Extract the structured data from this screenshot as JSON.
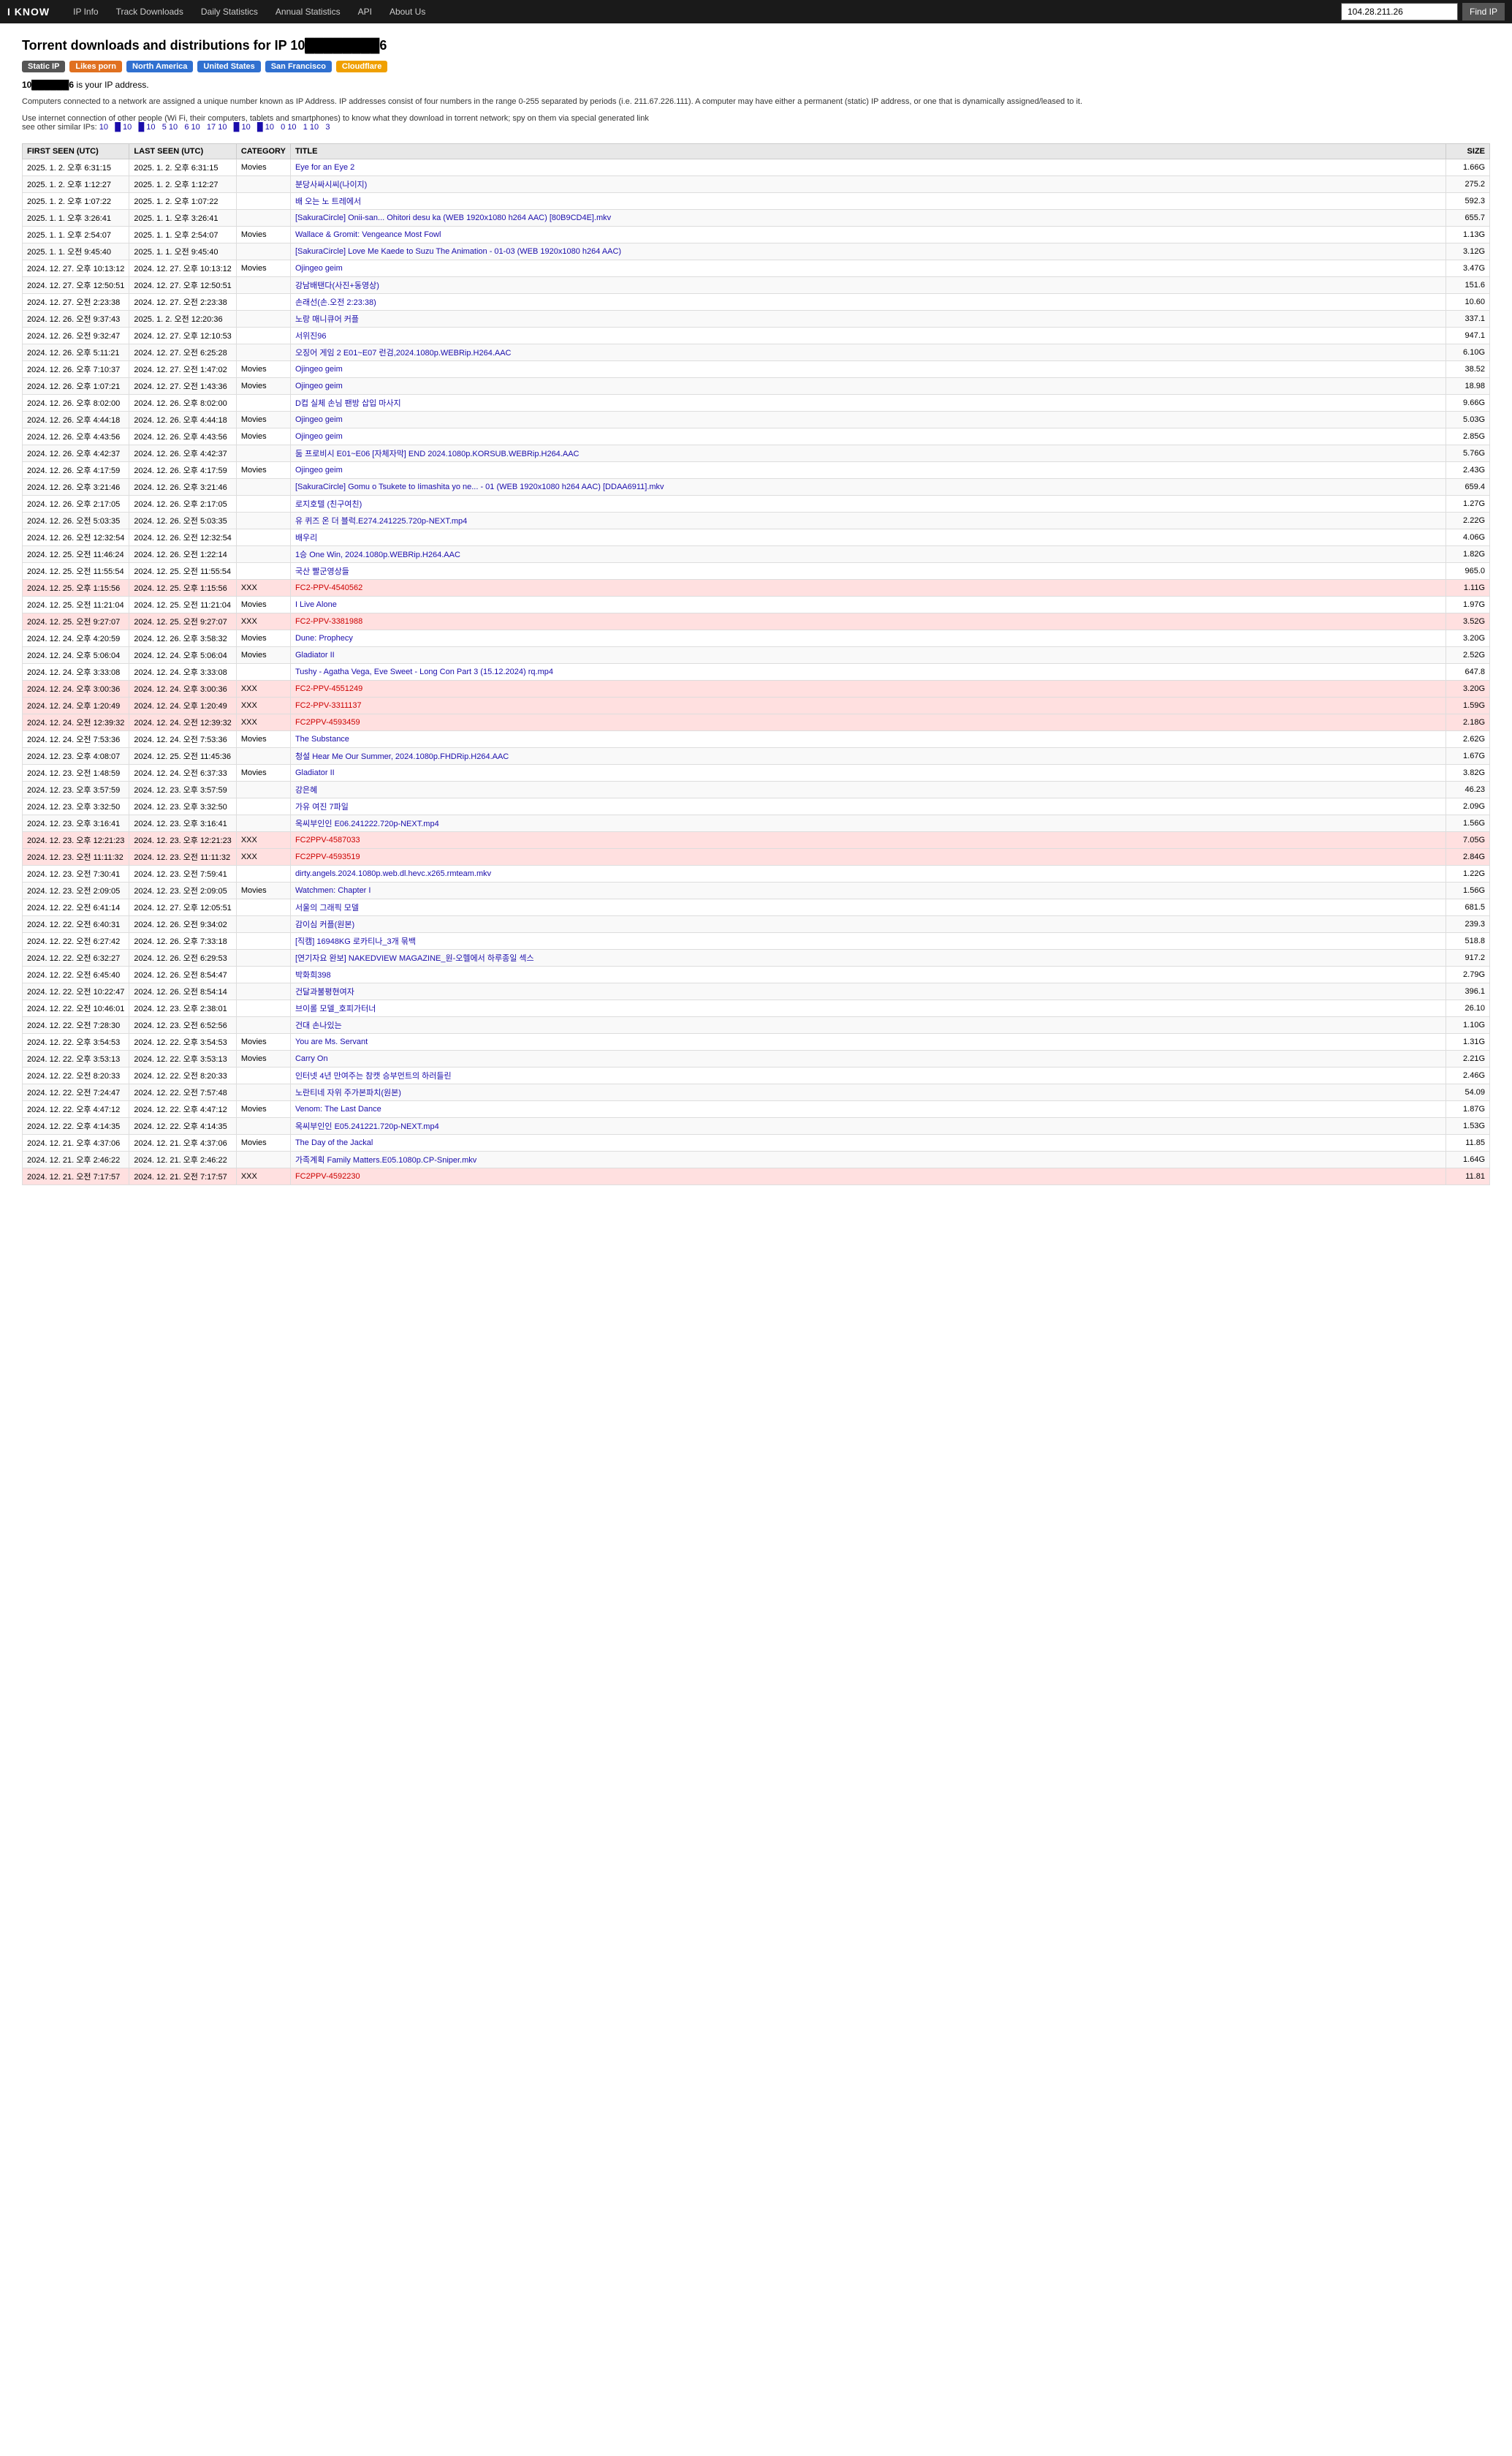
{
  "nav": {
    "logo": "I KNOW",
    "links": [
      {
        "label": "IP Info",
        "id": "ip-info"
      },
      {
        "label": "Track Downloads",
        "id": "track-downloads"
      },
      {
        "label": "Daily Statistics",
        "id": "daily-statistics"
      },
      {
        "label": "Annual Statistics",
        "id": "annual-statistics"
      },
      {
        "label": "API",
        "id": "api"
      },
      {
        "label": "About Us",
        "id": "about-us"
      }
    ],
    "search_value": "104.28.211.26",
    "search_button": "Find IP"
  },
  "header": {
    "title_prefix": "Torrent downloads and distributions for IP 10",
    "title_suffix": "6",
    "ip_display": "10██████6"
  },
  "tags": [
    {
      "label": "Static IP",
      "class": "tag-static"
    },
    {
      "label": "Likes porn",
      "class": "tag-likes"
    },
    {
      "label": "North America",
      "class": "tag-na"
    },
    {
      "label": "United States",
      "class": "tag-us"
    },
    {
      "label": "San Francisco",
      "class": "tag-sf"
    },
    {
      "label": "Cloudflare",
      "class": "tag-cloud"
    }
  ],
  "ip_label": "10██████6 is your IP address.",
  "description": "Computers connected to a network are assigned a unique number known as IP Address. IP addresses consist of four numbers in the range 0-255 separated by periods (i.e. 211.67.226.111). A computer may have either a permanent (static) IP address, or one that is dynamically assigned/leased to it.",
  "usage_text": "Use internet connection of other people (Wi Fi, their computers, tablets and smartphones) to know what they download in torrent network;",
  "similar_label": "see other similar IPs:",
  "similar_ips": [
    "10",
    "█ 10",
    "█ 10",
    "5 10",
    "6 10",
    "17 10",
    "█ 10",
    "█ 10",
    "0 10",
    "1 10",
    "3"
  ],
  "columns": [
    "FIRST SEEN (UTC)",
    "LAST SEEN (UTC)",
    "CATEGORY",
    "TITLE",
    "SIZE"
  ],
  "rows": [
    {
      "first": "2025. 1. 2. 오후 6:31:15",
      "last": "2025. 1. 2. 오후 6:31:15",
      "cat": "Movies",
      "title": "Eye for an Eye 2",
      "size": "1.66G",
      "xxx": false
    },
    {
      "first": "2025. 1. 2. 오후 1:12:27",
      "last": "2025. 1. 2. 오후 1:12:27",
      "cat": "",
      "title": "분당사싸시씨(나이지)",
      "size": "275.2",
      "xxx": false
    },
    {
      "first": "2025. 1. 2. 오후 1:07:22",
      "last": "2025. 1. 2. 오후 1:07:22",
      "cat": "",
      "title": "배 오는 노 트레에서",
      "size": "592.3",
      "xxx": false
    },
    {
      "first": "2025. 1. 1. 오후 3:26:41",
      "last": "2025. 1. 1. 오후 3:26:41",
      "cat": "",
      "title": "[SakuraCircle] Onii-san... Ohitori desu ka (WEB 1920x1080 h264 AAC) [80B9CD4E].mkv",
      "size": "655.7",
      "xxx": false
    },
    {
      "first": "2025. 1. 1. 오후 2:54:07",
      "last": "2025. 1. 1. 오후 2:54:07",
      "cat": "Movies",
      "title": "Wallace & Gromit: Vengeance Most Fowl",
      "size": "1.13G",
      "xxx": false
    },
    {
      "first": "2025. 1. 1. 오전 9:45:40",
      "last": "2025. 1. 1. 오전 9:45:40",
      "cat": "",
      "title": "[SakuraCircle] Love Me Kaede to Suzu The Animation - 01-03 (WEB 1920x1080 h264 AAC)",
      "size": "3.12G",
      "xxx": false
    },
    {
      "first": "2024. 12. 27. 오후 10:13:12",
      "last": "2024. 12. 27. 오후 10:13:12",
      "cat": "Movies",
      "title": "Ojingeo geim",
      "size": "3.47G",
      "xxx": false
    },
    {
      "first": "2024. 12. 27. 오후 12:50:51",
      "last": "2024. 12. 27. 오후 12:50:51",
      "cat": "",
      "title": "강남배탠다(사진+동영상)",
      "size": "151.6",
      "xxx": false
    },
    {
      "first": "2024. 12. 27. 오전 2:23:38",
      "last": "2024. 12. 27. 오전 2:23:38",
      "cat": "",
      "title": "손래선(손.오전 2:23:38)",
      "size": "10.60",
      "xxx": false
    },
    {
      "first": "2024. 12. 26. 오전 9:37:43",
      "last": "2025. 1. 2. 오전 12:20:36",
      "cat": "",
      "title": "노랑 매니큐어 커플",
      "size": "337.1",
      "xxx": false
    },
    {
      "first": "2024. 12. 26. 오전 9:32:47",
      "last": "2024. 12. 27. 오후 12:10:53",
      "cat": "",
      "title": "서위진96",
      "size": "947.1",
      "xxx": false
    },
    {
      "first": "2024. 12. 26. 오후 5:11:21",
      "last": "2024. 12. 27. 오전 6:25:28",
      "cat": "",
      "title": "오징어 게임 2 E01~E07 런검,2024.1080p.WEBRip.H264.AAC",
      "size": "6.10G",
      "xxx": false
    },
    {
      "first": "2024. 12. 26. 오후 7:10:37",
      "last": "2024. 12. 27. 오전 1:47:02",
      "cat": "Movies",
      "title": "Ojingeo geim",
      "size": "38.52",
      "xxx": false
    },
    {
      "first": "2024. 12. 26. 오후 1:07:21",
      "last": "2024. 12. 27. 오전 1:43:36",
      "cat": "Movies",
      "title": "Ojingeo geim",
      "size": "18.98",
      "xxx": false
    },
    {
      "first": "2024. 12. 26. 오후 8:02:00",
      "last": "2024. 12. 26. 오후 8:02:00",
      "cat": "",
      "title": "D컵 실체 손님 팬방 삽입 마사지",
      "size": "9.66G",
      "xxx": false
    },
    {
      "first": "2024. 12. 26. 오후 4:44:18",
      "last": "2024. 12. 26. 오후 4:44:18",
      "cat": "Movies",
      "title": "Ojingeo geim",
      "size": "5.03G",
      "xxx": false
    },
    {
      "first": "2024. 12. 26. 오후 4:43:56",
      "last": "2024. 12. 26. 오후 4:43:56",
      "cat": "Movies",
      "title": "Ojingeo geim",
      "size": "2.85G",
      "xxx": false
    },
    {
      "first": "2024. 12. 26. 오후 4:42:37",
      "last": "2024. 12. 26. 오후 4:42:37",
      "cat": "",
      "title": "둠 프로비시 E01~E06 [자체자막] END 2024.1080p.KORSUB.WEBRip.H264.AAC",
      "size": "5.76G",
      "xxx": false
    },
    {
      "first": "2024. 12. 26. 오후 4:17:59",
      "last": "2024. 12. 26. 오후 4:17:59",
      "cat": "Movies",
      "title": "Ojingeo geim",
      "size": "2.43G",
      "xxx": false
    },
    {
      "first": "2024. 12. 26. 오후 3:21:46",
      "last": "2024. 12. 26. 오후 3:21:46",
      "cat": "",
      "title": "[SakuraCircle] Gomu o Tsukete to Iimashita yo ne... - 01 (WEB 1920x1080 h264 AAC) [DDAA6911].mkv",
      "size": "659.4",
      "xxx": false
    },
    {
      "first": "2024. 12. 26. 오후 2:17:05",
      "last": "2024. 12. 26. 오후 2:17:05",
      "cat": "",
      "title": "로지호텔 (친구여친)",
      "size": "1.27G",
      "xxx": false
    },
    {
      "first": "2024. 12. 26. 오전 5:03:35",
      "last": "2024. 12. 26. 오전 5:03:35",
      "cat": "",
      "title": "유 퀴즈 온 더 블럭.E274.241225.720p-NEXT.mp4",
      "size": "2.22G",
      "xxx": false
    },
    {
      "first": "2024. 12. 26. 오전 12:32:54",
      "last": "2024. 12. 26. 오전 12:32:54",
      "cat": "",
      "title": "배우리",
      "size": "4.06G",
      "xxx": false
    },
    {
      "first": "2024. 12. 25. 오전 11:46:24",
      "last": "2024. 12. 26. 오전 1:22:14",
      "cat": "",
      "title": "1승 One Win, 2024.1080p.WEBRip.H264.AAC",
      "size": "1.82G",
      "xxx": false
    },
    {
      "first": "2024. 12. 25. 오전 11:55:54",
      "last": "2024. 12. 25. 오전 11:55:54",
      "cat": "",
      "title": "국산 빨군영상들",
      "size": "965.0",
      "xxx": false
    },
    {
      "first": "2024. 12. 25. 오후 1:15:56",
      "last": "2024. 12. 25. 오후 1:15:56",
      "cat": "XXX",
      "title": "FC2-PPV-4540562",
      "size": "1.11G",
      "xxx": true
    },
    {
      "first": "2024. 12. 25. 오전 11:21:04",
      "last": "2024. 12. 25. 오전 11:21:04",
      "cat": "Movies",
      "title": "I Live Alone",
      "size": "1.97G",
      "xxx": false
    },
    {
      "first": "2024. 12. 25. 오전 9:27:07",
      "last": "2024. 12. 25. 오전 9:27:07",
      "cat": "XXX",
      "title": "FC2-PPV-3381988",
      "size": "3.52G",
      "xxx": true
    },
    {
      "first": "2024. 12. 24. 오후 4:20:59",
      "last": "2024. 12. 26. 오후 3:58:32",
      "cat": "Movies",
      "title": "Dune: Prophecy",
      "size": "3.20G",
      "xxx": false
    },
    {
      "first": "2024. 12. 24. 오후 5:06:04",
      "last": "2024. 12. 24. 오후 5:06:04",
      "cat": "Movies",
      "title": "Gladiator II",
      "size": "2.52G",
      "xxx": false
    },
    {
      "first": "2024. 12. 24. 오후 3:33:08",
      "last": "2024. 12. 24. 오후 3:33:08",
      "cat": "",
      "title": "Tushy - Agatha Vega, Eve Sweet - Long Con Part 3 (15.12.2024) rq.mp4",
      "size": "647.8",
      "xxx": false
    },
    {
      "first": "2024. 12. 24. 오후 3:00:36",
      "last": "2024. 12. 24. 오후 3:00:36",
      "cat": "XXX",
      "title": "FC2-PPV-4551249",
      "size": "3.20G",
      "xxx": true
    },
    {
      "first": "2024. 12. 24. 오후 1:20:49",
      "last": "2024. 12. 24. 오후 1:20:49",
      "cat": "XXX",
      "title": "FC2-PPV-3311137",
      "size": "1.59G",
      "xxx": true
    },
    {
      "first": "2024. 12. 24. 오전 12:39:32",
      "last": "2024. 12. 24. 오전 12:39:32",
      "cat": "XXX",
      "title": "FC2PPV-4593459",
      "size": "2.18G",
      "xxx": true
    },
    {
      "first": "2024. 12. 24. 오전 7:53:36",
      "last": "2024. 12. 24. 오전 7:53:36",
      "cat": "Movies",
      "title": "The Substance",
      "size": "2.62G",
      "xxx": false
    },
    {
      "first": "2024. 12. 23. 오후 4:08:07",
      "last": "2024. 12. 25. 오전 11:45:36",
      "cat": "",
      "title": "청설 Hear Me Our Summer, 2024.1080p.FHDRip.H264.AAC",
      "size": "1.67G",
      "xxx": false
    },
    {
      "first": "2024. 12. 23. 오전 1:48:59",
      "last": "2024. 12. 24. 오전 6:37:33",
      "cat": "Movies",
      "title": "Gladiator II",
      "size": "3.82G",
      "xxx": false
    },
    {
      "first": "2024. 12. 23. 오후 3:57:59",
      "last": "2024. 12. 23. 오후 3:57:59",
      "cat": "",
      "title": "강은혜",
      "size": "46.23",
      "xxx": false
    },
    {
      "first": "2024. 12. 23. 오후 3:32:50",
      "last": "2024. 12. 23. 오후 3:32:50",
      "cat": "",
      "title": "가유 여진 7파일",
      "size": "2.09G",
      "xxx": false
    },
    {
      "first": "2024. 12. 23. 오후 3:16:41",
      "last": "2024. 12. 23. 오후 3:16:41",
      "cat": "",
      "title": "옥씨부인인 E06.241222.720p-NEXT.mp4",
      "size": "1.56G",
      "xxx": false
    },
    {
      "first": "2024. 12. 23. 오후 12:21:23",
      "last": "2024. 12. 23. 오후 12:21:23",
      "cat": "XXX",
      "title": "FC2PPV-4587033",
      "size": "7.05G",
      "xxx": true
    },
    {
      "first": "2024. 12. 23. 오전 11:11:32",
      "last": "2024. 12. 23. 오전 11:11:32",
      "cat": "XXX",
      "title": "FC2PPV-4593519",
      "size": "2.84G",
      "xxx": true
    },
    {
      "first": "2024. 12. 23. 오전 7:30:41",
      "last": "2024. 12. 23. 오전 7:59:41",
      "cat": "",
      "title": "dirty.angels.2024.1080p.web.dl.hevc.x265.rmteam.mkv",
      "size": "1.22G",
      "xxx": false
    },
    {
      "first": "2024. 12. 23. 오전 2:09:05",
      "last": "2024. 12. 23. 오전 2:09:05",
      "cat": "Movies",
      "title": "Watchmen: Chapter I",
      "size": "1.56G",
      "xxx": false
    },
    {
      "first": "2024. 12. 22. 오전 6:41:14",
      "last": "2024. 12. 27. 오후 12:05:51",
      "cat": "",
      "title": "서울의 그래픽 모델",
      "size": "681.5",
      "xxx": false
    },
    {
      "first": "2024. 12. 22. 오전 6:40:31",
      "last": "2024. 12. 26. 오전 9:34:02",
      "cat": "",
      "title": "감이심 커플(원본)",
      "size": "239.3",
      "xxx": false
    },
    {
      "first": "2024. 12. 22. 오전 6:27:42",
      "last": "2024. 12. 26. 오후 7:33:18",
      "cat": "",
      "title": "[직캠] 16948KG 로카티나_3개 묶백",
      "size": "518.8",
      "xxx": false
    },
    {
      "first": "2024. 12. 22. 오전 6:32:27",
      "last": "2024. 12. 26. 오전 6:29:53",
      "cat": "",
      "title": "[연기자요 완보] NAKEDVIEW MAGAZINE_원-오헬에서 하루종일 섹스",
      "size": "917.2",
      "xxx": false
    },
    {
      "first": "2024. 12. 22. 오전 6:45:40",
      "last": "2024. 12. 26. 오전 8:54:47",
      "cat": "",
      "title": "박화희398",
      "size": "2.79G",
      "xxx": false
    },
    {
      "first": "2024. 12. 22. 오전 10:22:47",
      "last": "2024. 12. 26. 오전 8:54:14",
      "cat": "",
      "title": "건달과불평현여자",
      "size": "396.1",
      "xxx": false
    },
    {
      "first": "2024. 12. 22. 오전 10:46:01",
      "last": "2024. 12. 23. 오후 2:38:01",
      "cat": "",
      "title": "브이롤 모델_호피가터너",
      "size": "26.10",
      "xxx": false
    },
    {
      "first": "2024. 12. 22. 오전 7:28:30",
      "last": "2024. 12. 23. 오전 6:52:56",
      "cat": "",
      "title": "건대 손나있는",
      "size": "1.10G",
      "xxx": false
    },
    {
      "first": "2024. 12. 22. 오후 3:54:53",
      "last": "2024. 12. 22. 오후 3:54:53",
      "cat": "Movies",
      "title": "You are Ms. Servant",
      "size": "1.31G",
      "xxx": false
    },
    {
      "first": "2024. 12. 22. 오후 3:53:13",
      "last": "2024. 12. 22. 오후 3:53:13",
      "cat": "Movies",
      "title": "Carry On",
      "size": "2.21G",
      "xxx": false
    },
    {
      "first": "2024. 12. 22. 오전 8:20:33",
      "last": "2024. 12. 22. 오전 8:20:33",
      "cat": "",
      "title": "인터넷 4년 만여주는 참캣 승부먼트의 하러들린",
      "size": "2.46G",
      "xxx": false
    },
    {
      "first": "2024. 12. 22. 오전 7:24:47",
      "last": "2024. 12. 22. 오전 7:57:48",
      "cat": "",
      "title": "노란티네 자위 주가본파치(원본)",
      "size": "54.09",
      "xxx": false
    },
    {
      "first": "2024. 12. 22. 오후 4:47:12",
      "last": "2024. 12. 22. 오후 4:47:12",
      "cat": "Movies",
      "title": "Venom: The Last Dance",
      "size": "1.87G",
      "xxx": false
    },
    {
      "first": "2024. 12. 22. 오후 4:14:35",
      "last": "2024. 12. 22. 오후 4:14:35",
      "cat": "",
      "title": "옥씨부인인 E05.241221.720p-NEXT.mp4",
      "size": "1.53G",
      "xxx": false
    },
    {
      "first": "2024. 12. 21. 오후 4:37:06",
      "last": "2024. 12. 21. 오후 4:37:06",
      "cat": "Movies",
      "title": "The Day of the Jackal",
      "size": "11.85",
      "xxx": false
    },
    {
      "first": "2024. 12. 21. 오후 2:46:22",
      "last": "2024. 12. 21. 오후 2:46:22",
      "cat": "",
      "title": "가족계획 Family Matters.E05.1080p.CP-Sniper.mkv",
      "size": "1.64G",
      "xxx": false
    },
    {
      "first": "2024. 12. 21. 오전 7:17:57",
      "last": "2024. 12. 21. 오전 7:17:57",
      "cat": "XXX",
      "title": "FC2PPV-4592230",
      "size": "11.81",
      "xxx": true
    }
  ]
}
